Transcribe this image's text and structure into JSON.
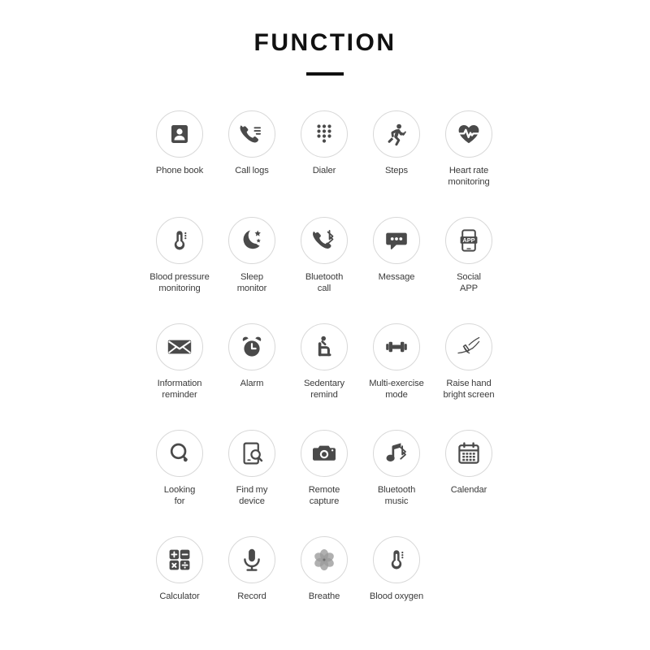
{
  "header": {
    "title": "FUNCTION",
    "divider": "title-rule"
  },
  "colors": {
    "background": "#ffffff",
    "title": "#111111",
    "label": "#3b3b3b",
    "circle_border": "#d8d8d8",
    "icon_dark": "#4a4a4a",
    "icon_light": "#9a9a9a"
  },
  "features": [
    {
      "label": "Phone book",
      "icon": "contact-card-icon"
    },
    {
      "label": "Call logs",
      "icon": "phone-log-icon"
    },
    {
      "label": "Dialer",
      "icon": "dialpad-icon"
    },
    {
      "label": "Steps",
      "icon": "running-person-icon"
    },
    {
      "label": "Heart rate\nmonitoring",
      "icon": "heart-pulse-icon"
    },
    {
      "label": "Blood pressure\nmonitoring",
      "icon": "thermometer-gauge-icon"
    },
    {
      "label": "Sleep\nmonitor",
      "icon": "moon-stars-icon"
    },
    {
      "label": "Bluetooth\ncall",
      "icon": "phone-bluetooth-icon"
    },
    {
      "label": "Message",
      "icon": "speech-bubble-icon"
    },
    {
      "label": "Social\nAPP",
      "icon": "phone-app-icon"
    },
    {
      "label": "Information\nreminder",
      "icon": "envelope-icon"
    },
    {
      "label": "Alarm",
      "icon": "alarm-clock-icon"
    },
    {
      "label": "Sedentary\nremind",
      "icon": "seated-person-icon"
    },
    {
      "label": "Multi-exercise\nmode",
      "icon": "dumbbell-icon"
    },
    {
      "label": "Raise hand\nbright screen",
      "icon": "raise-wrist-icon"
    },
    {
      "label": "Looking\nfor",
      "icon": "magnifier-icon"
    },
    {
      "label": "Find my\ndevice",
      "icon": "phone-search-icon"
    },
    {
      "label": "Remote\ncapture",
      "icon": "camera-icon"
    },
    {
      "label": "Bluetooth\nmusic",
      "icon": "music-bluetooth-icon"
    },
    {
      "label": "Calendar",
      "icon": "calendar-icon"
    },
    {
      "label": "Calculator",
      "icon": "calculator-icon"
    },
    {
      "label": "Record",
      "icon": "microphone-icon"
    },
    {
      "label": "Breathe",
      "icon": "flower-breathe-icon"
    },
    {
      "label": "Blood oxygen",
      "icon": "blood-oxygen-icon"
    }
  ]
}
